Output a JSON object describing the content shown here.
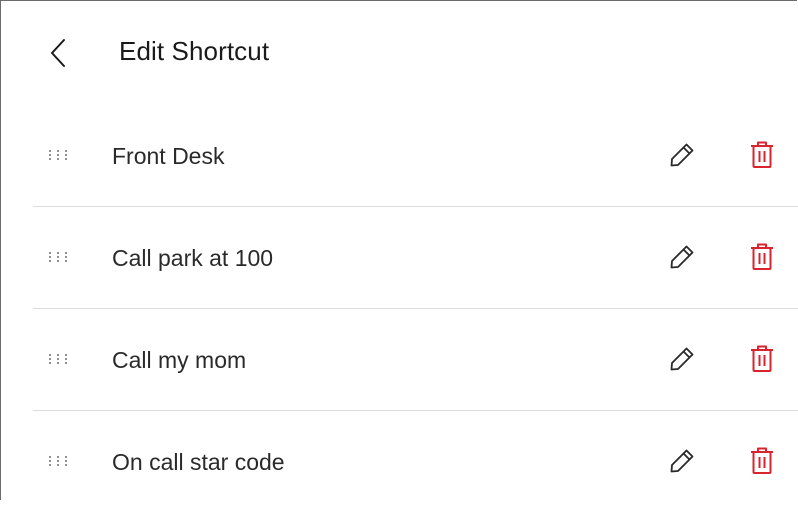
{
  "header": {
    "back_icon": "chevron-left-icon",
    "title": "Edit Shortcut"
  },
  "shortcuts": [
    {
      "label": "Front Desk"
    },
    {
      "label": "Call park at 100"
    },
    {
      "label": "Call my mom"
    },
    {
      "label": "On call star code"
    }
  ],
  "icons": {
    "drag": "drag-handle-icon",
    "edit": "pencil-icon",
    "delete": "trash-icon"
  },
  "colors": {
    "delete_icon": "#d9232e",
    "text": "#2a2a2a",
    "divider": "#dcdcdc"
  }
}
